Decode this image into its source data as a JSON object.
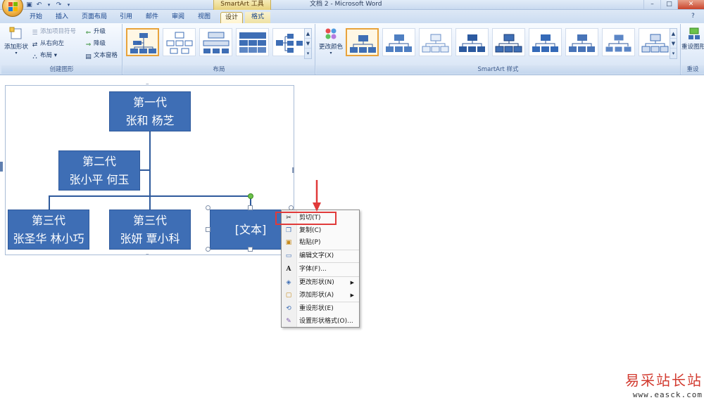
{
  "titlebar": {
    "context_tool": "SmartArt 工具",
    "window_title": "文档 2 - Microsoft Word",
    "controls": [
      "–",
      "□",
      "✕"
    ]
  },
  "tabs": [
    {
      "label": "开始"
    },
    {
      "label": "插入"
    },
    {
      "label": "页面布局"
    },
    {
      "label": "引用"
    },
    {
      "label": "邮件"
    },
    {
      "label": "审阅"
    },
    {
      "label": "视图"
    },
    {
      "label": "设计"
    },
    {
      "label": "格式"
    }
  ],
  "ribbon": {
    "create_graphic": {
      "label": "创建图形",
      "add_shape": "添加形状",
      "add_bullet": "添加项目符号",
      "right_to_left": "从右向左",
      "layout": "布局",
      "promote": "升级",
      "demote": "降级",
      "text_pane": "文本窗格"
    },
    "layouts": {
      "label": "布局"
    },
    "styles": {
      "label": "SmartArt 样式",
      "change_colors": "更改颜色"
    },
    "reset": {
      "label": "重设",
      "reset_graphic": "重设图形"
    }
  },
  "diagram": {
    "nodes": [
      {
        "line1": "第一代",
        "line2": "张和  杨芝"
      },
      {
        "line1": "第二代",
        "line2": "张小平  何玉"
      },
      {
        "line1": "第三代",
        "line2": "张圣华  林小巧"
      },
      {
        "line1": "第三代",
        "line2": "张妍  覃小科"
      },
      {
        "line1": "[文本]",
        "line2": ""
      }
    ]
  },
  "context_menu": {
    "items": [
      {
        "label": "剪切(T)",
        "icon": "scissors-icon"
      },
      {
        "label": "复制(C)",
        "icon": "copy-icon"
      },
      {
        "label": "粘贴(P)",
        "icon": "paste-icon"
      },
      {
        "label": "编辑文字(X)",
        "icon": "edit-text-icon"
      },
      {
        "label": "字体(F)...",
        "icon": "font-icon"
      },
      {
        "label": "更改形状(N)",
        "icon": "change-shape-icon",
        "submenu": true
      },
      {
        "label": "添加形状(A)",
        "icon": "add-shape-icon",
        "submenu": true
      },
      {
        "label": "重设形状(E)",
        "icon": "reset-shape-icon"
      },
      {
        "label": "设置形状格式(O)...",
        "icon": "format-shape-icon"
      }
    ]
  },
  "watermark": {
    "name": "易采站长站",
    "url": "www.easck.com"
  },
  "colors": {
    "node_fill": "#3e6eb5",
    "highlight": "#e03a3a",
    "watermark": "#d23a2f"
  }
}
